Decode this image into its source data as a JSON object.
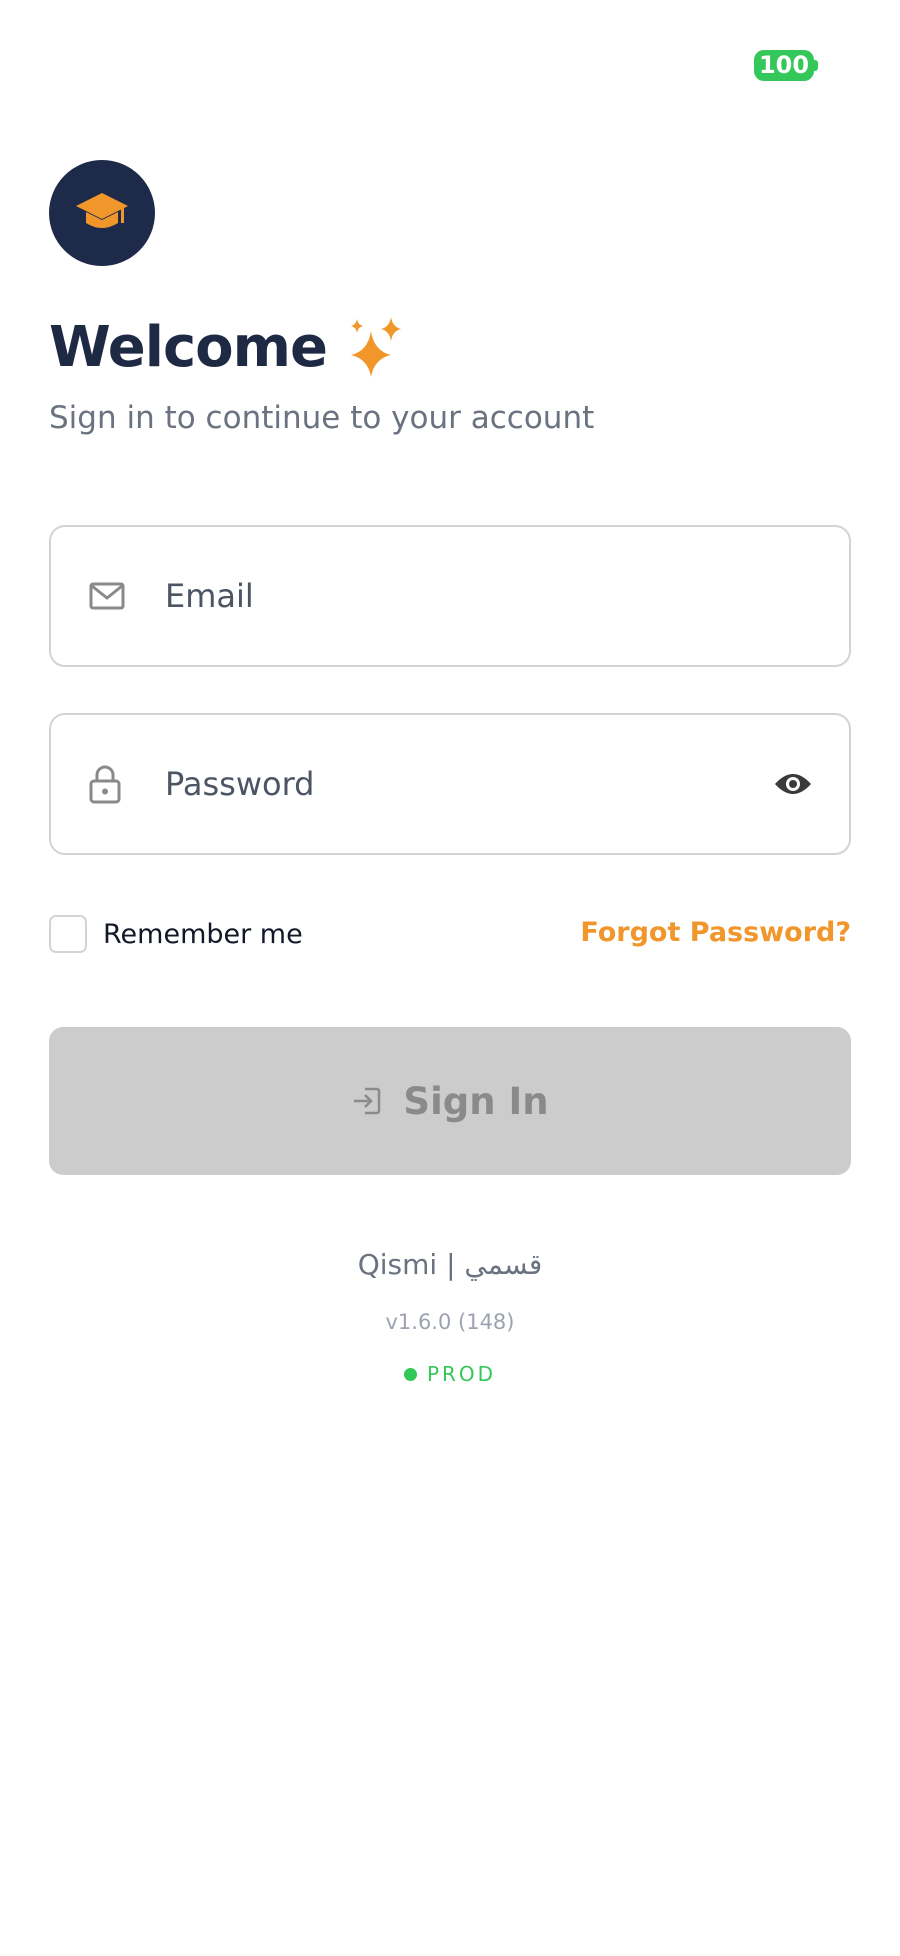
{
  "status_bar": {
    "battery_level": "100"
  },
  "header": {
    "logo_icon": "graduation-cap-icon",
    "title": "Welcome",
    "title_icon": "sparkles-icon",
    "subtitle": "Sign in to continue to your account"
  },
  "form": {
    "email": {
      "placeholder": "Email",
      "icon": "mail-icon"
    },
    "password": {
      "placeholder": "Password",
      "icon": "lock-icon",
      "toggle_icon": "eye-icon"
    },
    "remember_label": "Remember me",
    "remember_checked": false,
    "forgot_label": "Forgot Password?",
    "submit_label": "Sign In",
    "submit_icon": "login-icon"
  },
  "footer": {
    "brand": "Qismi | قسمي",
    "version": "v1.6.0 (148)",
    "environment": "PROD"
  },
  "colors": {
    "primary_navy": "#1e2a4a",
    "accent_orange": "#f0962a",
    "disabled_button": "#cccccc",
    "success_green": "#34c759"
  }
}
